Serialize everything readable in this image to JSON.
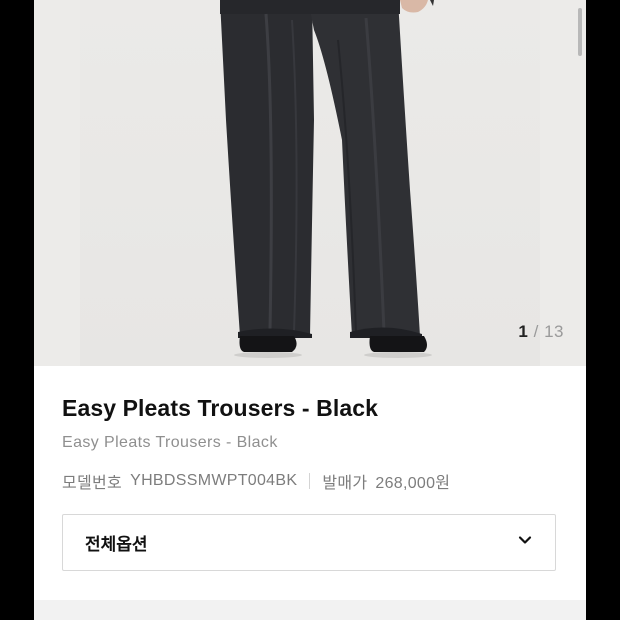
{
  "gallery": {
    "current": "1",
    "separator": "/",
    "total": "13"
  },
  "product": {
    "title": "Easy Pleats Trousers - Black",
    "subtitle": "Easy Pleats Trousers - Black",
    "model_label": "모델번호",
    "model_value": "YHBDSSMWPT004BK",
    "price_label": "발매가",
    "price_value": "268,000원"
  },
  "options": {
    "label": "전체옵션"
  },
  "icons": {
    "dropdown": "chevron-down-icon"
  },
  "colors": {
    "trousers": "#2b2c30",
    "photo_background": "#e9e8e6",
    "text_primary": "#111111",
    "text_secondary": "#8f8f8f"
  }
}
